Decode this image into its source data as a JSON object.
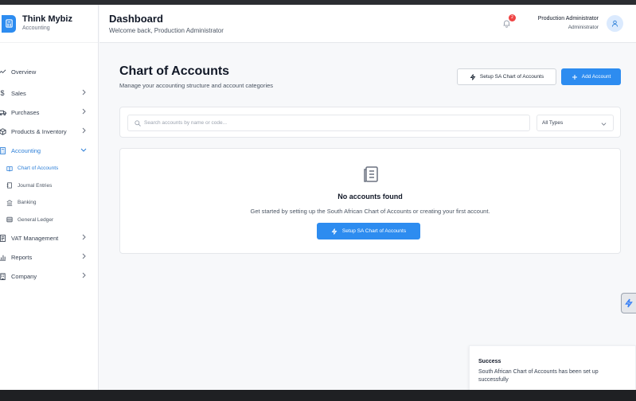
{
  "brand": {
    "name": "Think Mybiz",
    "subtitle": "Accounting"
  },
  "sidebar": {
    "items": [
      {
        "label": "Overview",
        "icon": "trend-icon"
      },
      {
        "label": "Sales",
        "icon": "dollar-icon"
      },
      {
        "label": "Purchases",
        "icon": "truck-icon"
      },
      {
        "label": "Products & Inventory",
        "icon": "box-icon"
      },
      {
        "label": "Accounting",
        "icon": "calculator-icon",
        "expanded": true
      },
      {
        "label": "VAT Management",
        "icon": "receipt-icon"
      },
      {
        "label": "Reports",
        "icon": "bar-chart-icon"
      },
      {
        "label": "Company",
        "icon": "building-icon"
      }
    ],
    "subitems": [
      {
        "label": "Chart of Accounts",
        "icon": "book-icon",
        "active": true
      },
      {
        "label": "Journal Entries",
        "icon": "journal-icon"
      },
      {
        "label": "Banking",
        "icon": "bank-icon"
      },
      {
        "label": "General Ledger",
        "icon": "ledger-icon"
      }
    ]
  },
  "header": {
    "title": "Dashboard",
    "subtitle": "Welcome back, Production Administrator",
    "notification_count": "2",
    "user_name": "Production Administrator",
    "user_role": "Administrator"
  },
  "main": {
    "title": "Chart of Accounts",
    "subtitle": "Manage your accounting structure and account categories",
    "setup_button": "Setup SA Chart of Accounts",
    "add_button": "Add Account",
    "search_placeholder": "Search accounts by name or code...",
    "type_filter": "All Types"
  },
  "empty_state": {
    "title": "No accounts found",
    "description": "Get started by setting up the South African Chart of Accounts or creating your first account.",
    "button": "Setup SA Chart of Accounts"
  },
  "toast": {
    "title": "Success",
    "message": "South African Chart of Accounts has been set up successfully"
  },
  "colors": {
    "primary": "#2d8cf0",
    "active_text": "#2d7fd8",
    "badge": "#ef4444"
  }
}
